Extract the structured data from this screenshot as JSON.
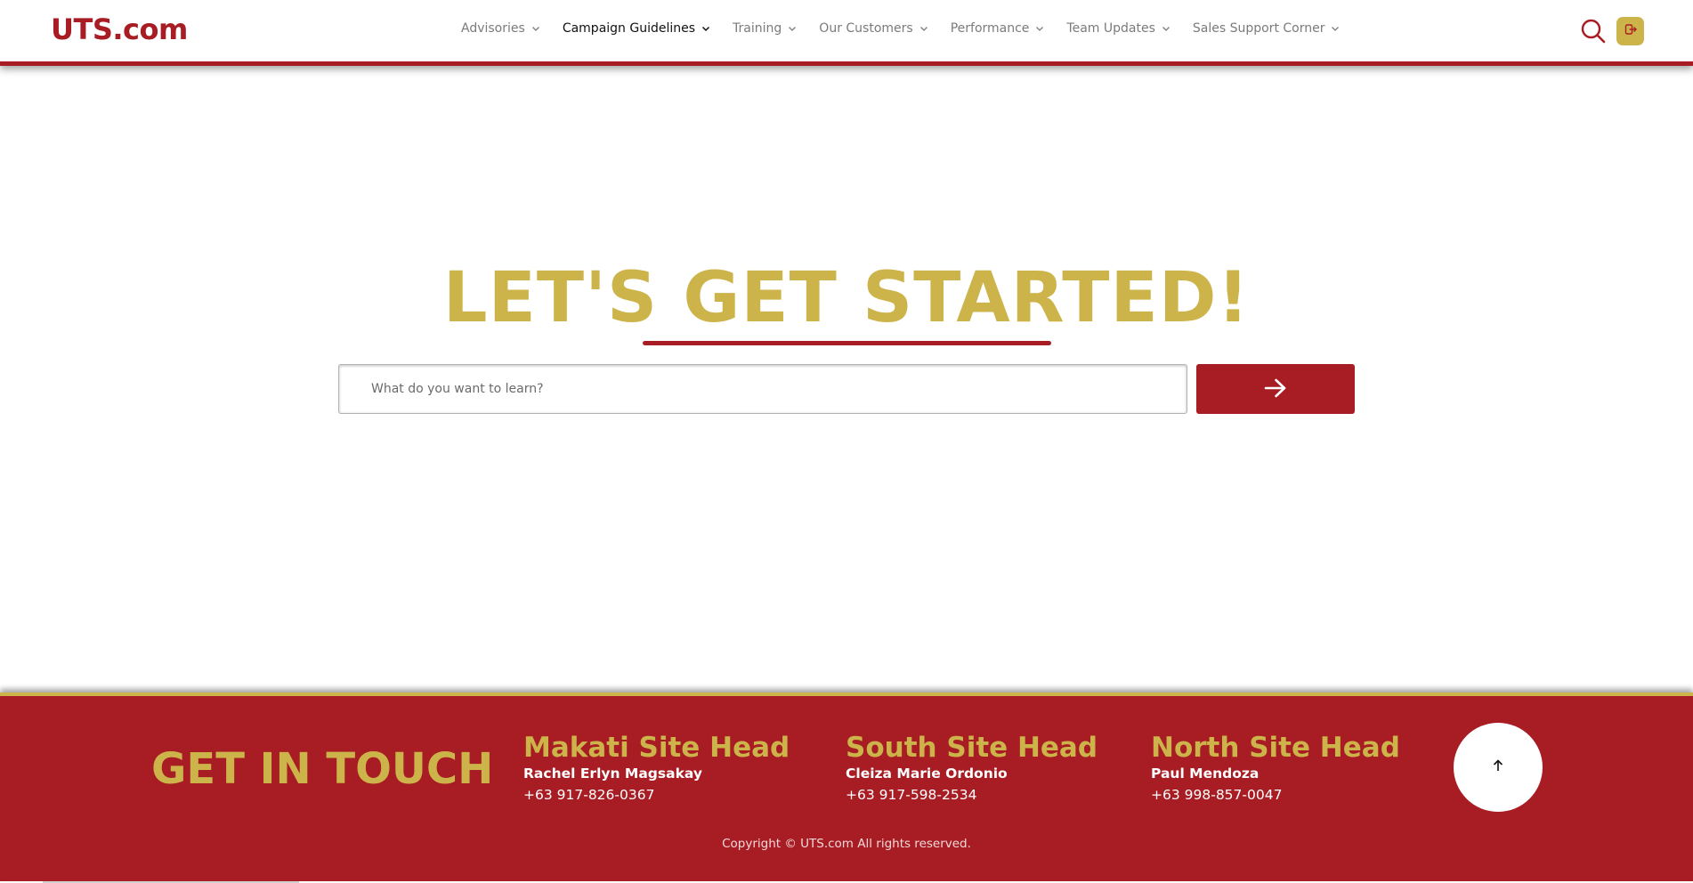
{
  "header": {
    "logo": "UTS.com",
    "nav": [
      {
        "label": "Advisories",
        "active": false
      },
      {
        "label": "Campaign Guidelines",
        "active": true
      },
      {
        "label": "Training",
        "active": false
      },
      {
        "label": "Our Customers",
        "active": false
      },
      {
        "label": "Performance",
        "active": false
      },
      {
        "label": "Team Updates",
        "active": false
      },
      {
        "label": "Sales Support Corner",
        "active": false
      }
    ],
    "icons": {
      "search": "search-icon",
      "logout": "logout-icon"
    }
  },
  "hero": {
    "title": "LET'S GET STARTED!",
    "search_placeholder": "What do you want to learn?",
    "submit_icon": "arrow-right-icon"
  },
  "footer": {
    "touch_title": "GET IN TOUCH",
    "sites": [
      {
        "title": "Makati Site Head",
        "name": "Rachel Erlyn Magsakay",
        "phone": "+63 917-826-0367"
      },
      {
        "title": "South Site Head",
        "name": "Cleiza Marie Ordonio",
        "phone": "+63 917-598-2534"
      },
      {
        "title": "North Site Head",
        "name": "Paul Mendoza",
        "phone": "+63 998-857-0047"
      }
    ],
    "back_to_top_icon": "arrow-up-icon",
    "copyright": "Copyright © UTS.com All rights reserved."
  },
  "colors": {
    "brand_red": "#a81c23",
    "brand_gold": "#cdb44a"
  }
}
